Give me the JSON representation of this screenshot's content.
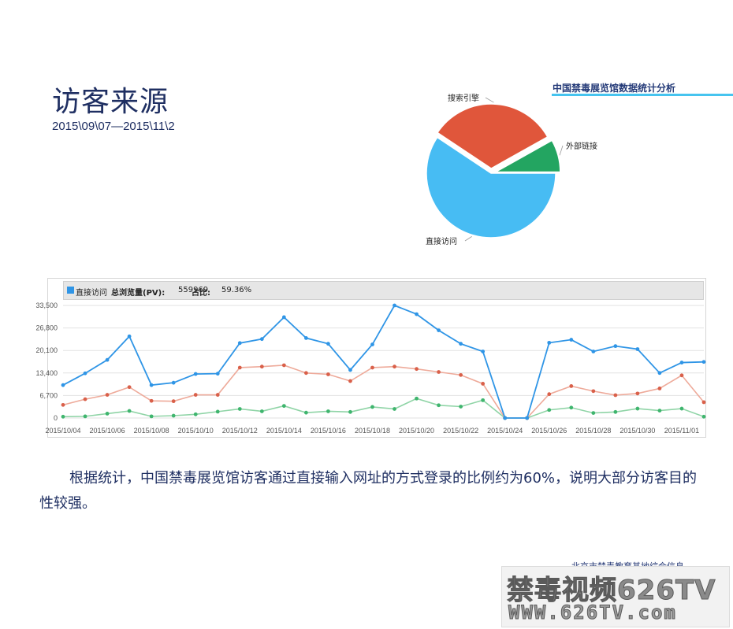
{
  "header": {
    "title": "访客来源",
    "date_range": "2015\\09\\07—2015\\11\\2",
    "report_title": "中国禁毒展览馆数据统计分析"
  },
  "colors": {
    "direct": "#47bcf3",
    "search": "#e0563b",
    "external": "#23a561",
    "line_direct": "#2f95e6",
    "line_search": "#eeaa9a",
    "line_external": "#8fd4a6",
    "accent_bar": "#46c4ef",
    "title_text": "#1f2f62"
  },
  "chart_data": [
    {
      "type": "pie",
      "slices": [
        {
          "label": "直接访问",
          "value": 59.36,
          "exploded": true
        },
        {
          "label": "搜索引擎",
          "value": 32.5
        },
        {
          "label": "外部链接",
          "value": 8.14
        }
      ]
    },
    {
      "type": "line",
      "legend": {
        "series_label": "直接访问",
        "pv_label": "总浏览量(PV):",
        "pv_value": "559969",
        "share_label": "占比:",
        "share_value": "59.36%"
      },
      "y_ticks": [
        "33,500",
        "26,800",
        "20,100",
        "13,400",
        "6,700",
        "0"
      ],
      "ylim": [
        0,
        33500
      ],
      "x_tick_labels": [
        "2015/10/04",
        "2015/10/06",
        "2015/10/08",
        "2015/10/10",
        "2015/10/12",
        "2015/10/14",
        "2015/10/16",
        "2015/10/18",
        "2015/10/20",
        "2015/10/22",
        "2015/10/24",
        "2015/10/26",
        "2015/10/28",
        "2015/10/30",
        "2015/11/01"
      ],
      "x_start": "2015/10/04",
      "grid": true,
      "series": [
        {
          "values": [
            9800,
            13300,
            17300,
            24300,
            9800,
            10500,
            13100,
            13200,
            22300,
            23500,
            30000,
            23800,
            22100,
            14300,
            21900,
            33500,
            30900,
            26100,
            22100,
            19800,
            0,
            0,
            22400,
            23300,
            19800,
            21400,
            20500,
            13400,
            16500,
            16700
          ]
        },
        {
          "values": [
            3900,
            5600,
            6900,
            9200,
            5100,
            5000,
            6900,
            6900,
            15000,
            15300,
            15700,
            13400,
            13000,
            11000,
            15000,
            15300,
            14600,
            13700,
            12800,
            10200,
            0,
            0,
            7100,
            9500,
            8000,
            6800,
            7300,
            8800,
            12700,
            4700
          ]
        },
        {
          "values": [
            400,
            500,
            1300,
            2100,
            500,
            700,
            1100,
            1900,
            2700,
            2000,
            3600,
            1600,
            2000,
            1800,
            3300,
            2700,
            5800,
            3800,
            3400,
            5300,
            0,
            0,
            2400,
            3100,
            1500,
            1800,
            2800,
            2200,
            2800,
            400
          ]
        }
      ]
    }
  ],
  "description": "根据统计，中国禁毒展览馆访客通过直接输入网址的方式登录的比例约为60%，说明大部分访客目的性较强。",
  "footer": {
    "org_text": "北京市禁毒教育基地综合信息",
    "watermark_line1": "禁毒视频626TV",
    "watermark_line2": "WWW.626TV.com"
  }
}
